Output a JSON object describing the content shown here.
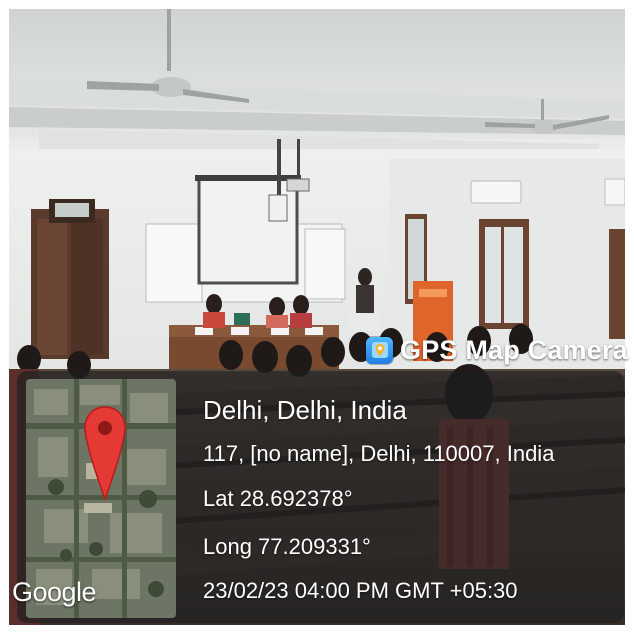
{
  "overlay": {
    "app_name": "GPS Map Camera",
    "map_brand": "Google",
    "location_title": "Delhi, Delhi, India",
    "address": "117, [no name], Delhi, 110007, India",
    "latitude": "Lat 28.692378°",
    "longitude": "Long 77.209331°",
    "timestamp": "23/02/23 04:00 PM GMT +05:30"
  },
  "icons": {
    "app_logo": "gps-map-camera-logo",
    "map_pin": "map-pin-icon"
  },
  "colors": {
    "panel_background": "#1c1e20",
    "pin_red": "#e53935",
    "logo_blue": "#2b8ff0",
    "text": "#ffffff"
  }
}
